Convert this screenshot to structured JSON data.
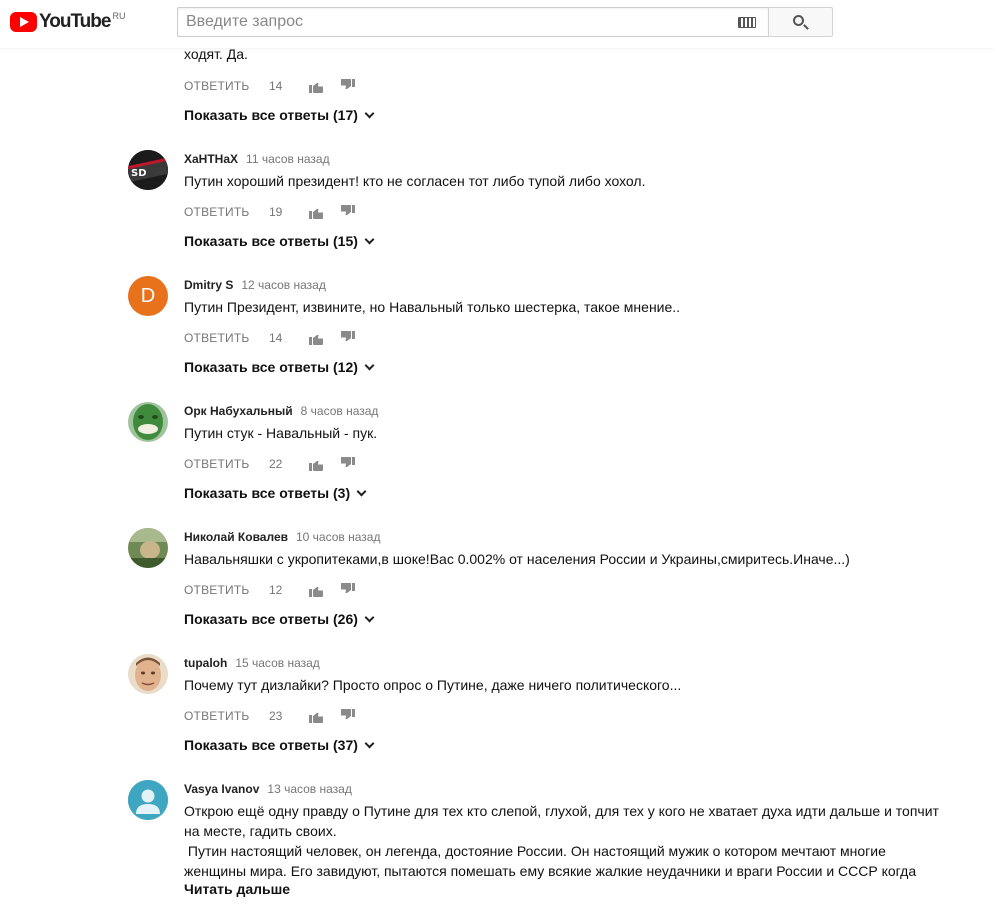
{
  "header": {
    "logo_text": "YouTube",
    "logo_country": "RU",
    "search_placeholder": "Введите запрос",
    "brand_color": "#ff0000"
  },
  "top_partial": {
    "text": "ходят. Да.",
    "reply_label": "ОТВЕТИТЬ",
    "likes": "14",
    "show_replies": "Показать все ответы (17)"
  },
  "comments": [
    {
      "author": "XaHTHaX",
      "time": "11 часов назад",
      "text": "Путин хороший президент! кто не согласен тот либо тупой либо хохол.",
      "reply_label": "ОТВЕТИТЬ",
      "likes": "19",
      "show_replies": "Показать все ответы (15)",
      "avatar_type": "image-dark"
    },
    {
      "author": "Dmitry S",
      "time": "12 часов назад",
      "text": "Путин Президент, извините, но Навальный только шестерка, такое мнение..",
      "reply_label": "ОТВЕТИТЬ",
      "likes": "14",
      "show_replies": "Показать все ответы (12)",
      "avatar_letter": "D",
      "avatar_color": "#e8711c"
    },
    {
      "author": "Орк Набухальный",
      "time": "8 часов назад",
      "text": "Путин стук - Навальный - пук.",
      "reply_label": "ОТВЕТИТЬ",
      "likes": "22",
      "show_replies": "Показать все ответы (3)",
      "avatar_type": "image-green"
    },
    {
      "author": "Николай Ковалев",
      "time": "10 часов назад",
      "text": "Навальняшки с укропитеками,в шоке!Вас 0.002% от населения России и Украины,смиритесь.Иначе...)",
      "reply_label": "ОТВЕТИТЬ",
      "likes": "12",
      "show_replies": "Показать все ответы (26)",
      "avatar_type": "image-nature"
    },
    {
      "author": "tupaloh",
      "time": "15 часов назад",
      "text": "Почему тут дизлайки? Просто опрос о Путине, даже ничего политического...",
      "reply_label": "ОТВЕТИТЬ",
      "likes": "23",
      "show_replies": "Показать все ответы (37)",
      "avatar_type": "image-face"
    },
    {
      "author": "Vasya Ivanov",
      "time": "13 часов назад",
      "text_line1": "Открою ещё одну правду о Путине для тех кто слепой, глухой, для тех у кого не хватает духа идти дальше и топчит",
      "text_line2": "на месте, гадить своих.",
      "text_line3": " Путин настоящий человек, он легенда, достояние России. Он настоящий мужик о котором мечтают многие",
      "text_line4": "женщины мира. Его завидуют, пытаются помешать ему всякие жалкие неудачники и враги России и СССР когда",
      "read_more": "Читать дальше",
      "avatar_type": "default-user",
      "avatar_color": "#3ea6c0"
    }
  ]
}
